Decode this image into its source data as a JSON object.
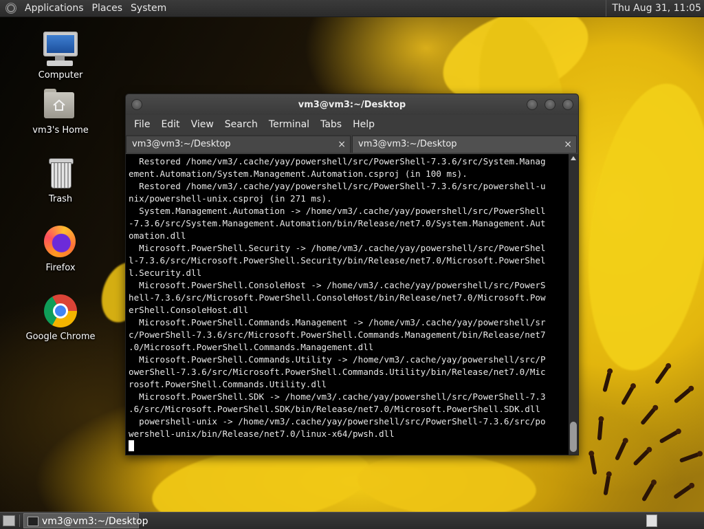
{
  "top_panel": {
    "menus": [
      "Applications",
      "Places",
      "System"
    ],
    "clock": "Thu Aug 31, 11:05"
  },
  "desktop_icons": [
    {
      "label": "Computer",
      "icon": "computer-icon"
    },
    {
      "label": "vm3's Home",
      "icon": "home-folder-icon"
    },
    {
      "label": "Trash",
      "icon": "trash-icon"
    },
    {
      "label": "Firefox",
      "icon": "firefox-icon"
    },
    {
      "label": "Google Chrome",
      "icon": "chrome-icon"
    }
  ],
  "terminal": {
    "title": "vm3@vm3:~/Desktop",
    "menu": [
      "File",
      "Edit",
      "View",
      "Search",
      "Terminal",
      "Tabs",
      "Help"
    ],
    "tabs": [
      {
        "label": "vm3@vm3:~/Desktop",
        "close": "×"
      },
      {
        "label": "vm3@vm3:~/Desktop",
        "close": "×"
      }
    ],
    "lines": [
      "  Restored /home/vm3/.cache/yay/powershell/src/PowerShell-7.3.6/src/System.Manag",
      "ement.Automation/System.Management.Automation.csproj (in 100 ms).",
      "  Restored /home/vm3/.cache/yay/powershell/src/PowerShell-7.3.6/src/powershell-u",
      "nix/powershell-unix.csproj (in 271 ms).",
      "  System.Management.Automation -> /home/vm3/.cache/yay/powershell/src/PowerShell",
      "-7.3.6/src/System.Management.Automation/bin/Release/net7.0/System.Management.Aut",
      "omation.dll",
      "  Microsoft.PowerShell.Security -> /home/vm3/.cache/yay/powershell/src/PowerShel",
      "l-7.3.6/src/Microsoft.PowerShell.Security/bin/Release/net7.0/Microsoft.PowerShel",
      "l.Security.dll",
      "  Microsoft.PowerShell.ConsoleHost -> /home/vm3/.cache/yay/powershell/src/PowerS",
      "hell-7.3.6/src/Microsoft.PowerShell.ConsoleHost/bin/Release/net7.0/Microsoft.Pow",
      "erShell.ConsoleHost.dll",
      "  Microsoft.PowerShell.Commands.Management -> /home/vm3/.cache/yay/powershell/sr",
      "c/PowerShell-7.3.6/src/Microsoft.PowerShell.Commands.Management/bin/Release/net7",
      ".0/Microsoft.PowerShell.Commands.Management.dll",
      "  Microsoft.PowerShell.Commands.Utility -> /home/vm3/.cache/yay/powershell/src/P",
      "owerShell-7.3.6/src/Microsoft.PowerShell.Commands.Utility/bin/Release/net7.0/Mic",
      "rosoft.PowerShell.Commands.Utility.dll",
      "  Microsoft.PowerShell.SDK -> /home/vm3/.cache/yay/powershell/src/PowerShell-7.3",
      ".6/src/Microsoft.PowerShell.SDK/bin/Release/net7.0/Microsoft.PowerShell.SDK.dll",
      "  powershell-unix -> /home/vm3/.cache/yay/powershell/src/PowerShell-7.3.6/src/po",
      "wershell-unix/bin/Release/net7.0/linux-x64/pwsh.dll"
    ]
  },
  "bottom_panel": {
    "task_label": "vm3@vm3:~/Desktop"
  }
}
